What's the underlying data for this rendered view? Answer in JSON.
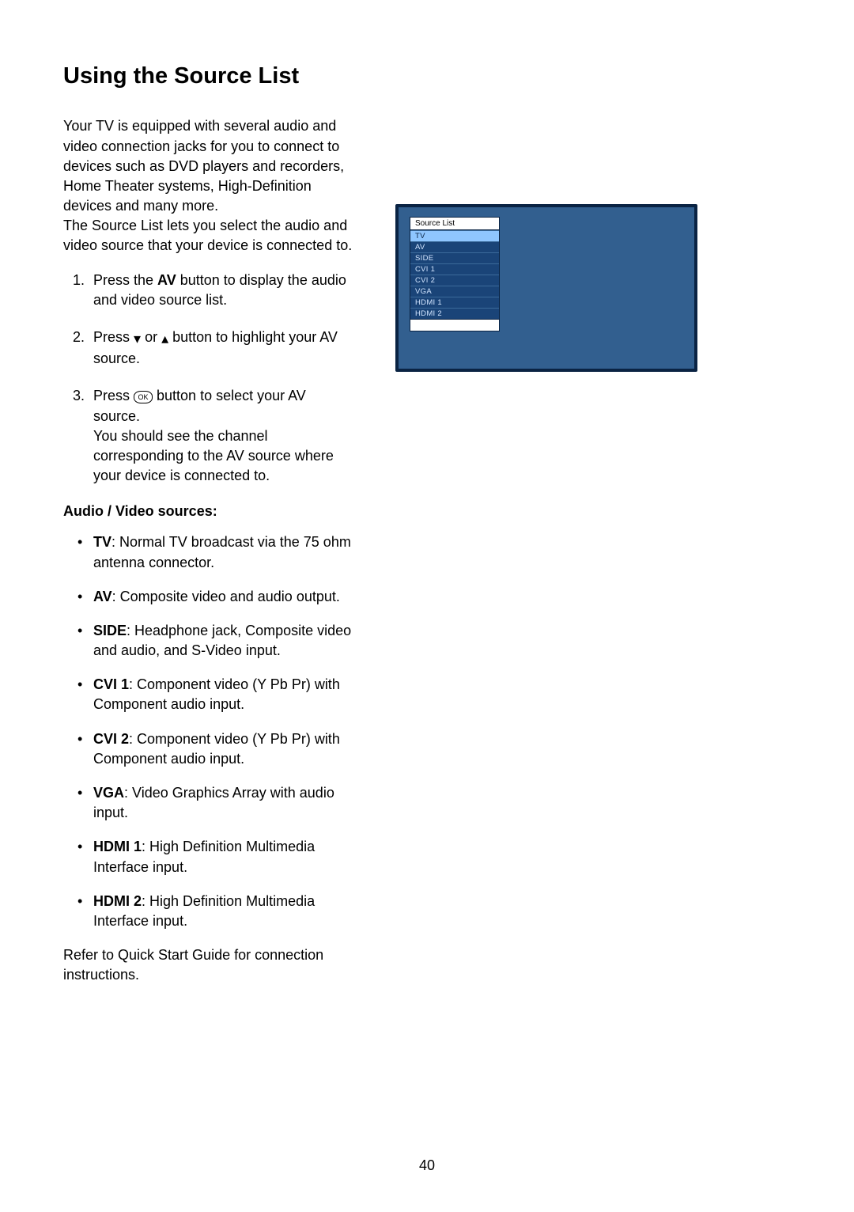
{
  "heading": "Using the Source List",
  "intro_para": "Your TV is equipped with several audio and video connection jacks for you to connect to devices such as DVD players and recorders, Home Theater systems, High-Definition devices and many more.",
  "intro_para2": "The Source List lets you select the audio and video source that your device is connected to.",
  "steps": {
    "s1_pre": "Press the ",
    "s1_bold": "AV",
    "s1_post": " button to display the audio and video source list.",
    "s2_pre": "Press ",
    "s2_or": " or ",
    "s2_post": " button to highlight your AV source.",
    "s3_pre": "Press ",
    "s3_post": " button to select your AV source.",
    "s3_follow": "You should see the channel corresponding to the AV source where your device is connected to."
  },
  "subhead": "Audio / Video sources:",
  "sources": [
    {
      "name": "TV",
      "desc": ": Normal TV broadcast via the 75 ohm antenna connector."
    },
    {
      "name": "AV",
      "desc": ": Composite video and audio output."
    },
    {
      "name": "SIDE",
      "desc": ": Headphone jack, Composite video and audio, and S-Video input."
    },
    {
      "name": "CVI 1",
      "desc": ": Component video (Y Pb Pr) with Component audio input."
    },
    {
      "name": "CVI 2",
      "desc": ": Component video (Y Pb Pr) with Component audio input."
    },
    {
      "name": "VGA",
      "desc": ": Video Graphics Array with audio input."
    },
    {
      "name": "HDMI 1",
      "desc": ": High Definition Multimedia Interface input."
    },
    {
      "name": "HDMI 2",
      "desc": ": High Definition Multimedia Interface input."
    }
  ],
  "outro": "Refer to Quick Start Guide for connection instructions.",
  "page_number": "40",
  "osd": {
    "header": "Source List",
    "items": [
      "TV",
      "AV",
      "SIDE",
      "CVI 1",
      "CVI 2",
      "VGA",
      "HDMI 1",
      "HDMI 2"
    ],
    "selected_index": 0
  },
  "icons": {
    "down": "▾",
    "up": "▴",
    "ok_label": "OK"
  }
}
